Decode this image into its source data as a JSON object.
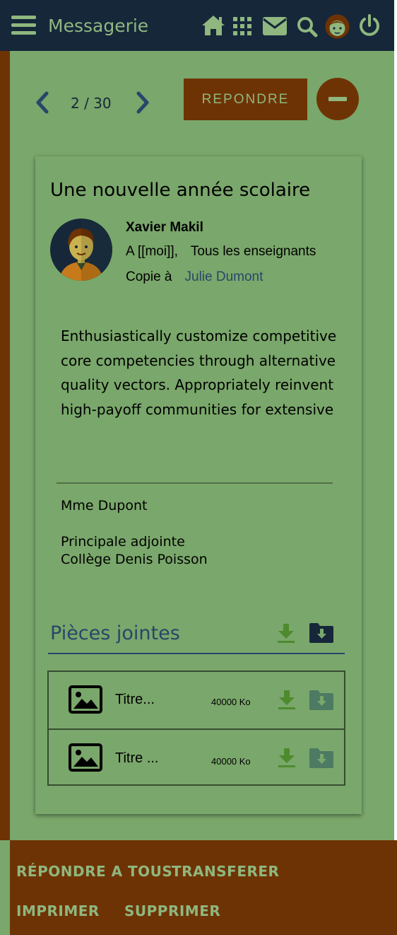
{
  "app": {
    "title": "Messagerie"
  },
  "colors": {
    "background": "#7aa76b",
    "navbar": "#16273a",
    "accent": "#6e3304",
    "accent_text": "#8fb77f",
    "link": "#26476a"
  },
  "header_icons": [
    "menu-icon",
    "home-icon",
    "apps-grid-icon",
    "mail-icon",
    "search-icon",
    "user-avatar-icon",
    "power-icon"
  ],
  "pager": {
    "current": "2",
    "separator": "/",
    "total": "30",
    "label": "2 / 30"
  },
  "reply_label": "REPONDRE",
  "message": {
    "subject": "Une nouvelle année scolaire",
    "sender": "Xavier Makil",
    "to_prefix": "A",
    "to_self": "[[moi]],",
    "to_group": "Tous les enseignants",
    "cc_prefix": "Copie à",
    "cc_name": "Julie Dumont",
    "body": "Enthusiastically customize competitive core competencies through alternative quality vectors. Appropriately reinvent high-payoff communities for extensive",
    "signature_name": "Mme Dupont",
    "signature_role": "Principale adjointe",
    "signature_org": "Collège Denis Poisson"
  },
  "attachments": {
    "title": "Pièces jointes",
    "items": [
      {
        "name": "Titre...",
        "size": "40000 Ko"
      },
      {
        "name": "Titre ...",
        "size": "40000 Ko"
      }
    ]
  },
  "actions": {
    "reply_all": "RÉPONDRE A TOUS",
    "forward": "TRANSFERER",
    "print": "IMPRIMER",
    "delete": "SUPPRIMER"
  }
}
